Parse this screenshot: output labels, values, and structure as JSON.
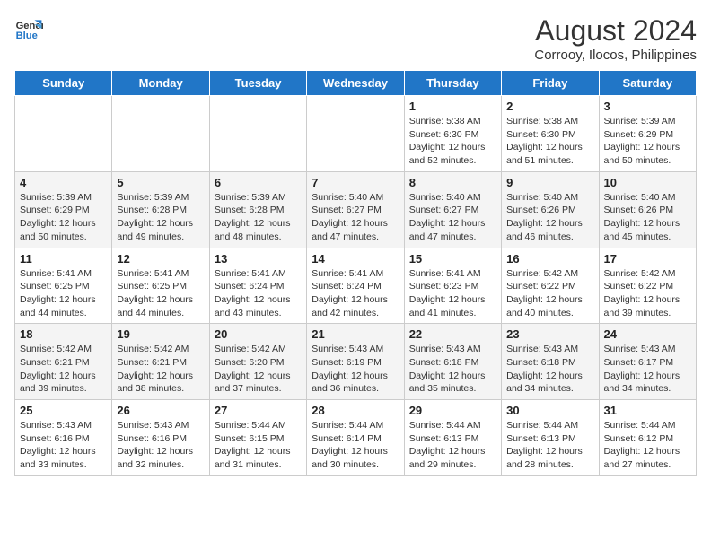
{
  "header": {
    "logo_line1": "General",
    "logo_line2": "Blue",
    "month_year": "August 2024",
    "location": "Corrooy, Ilocos, Philippines"
  },
  "days_of_week": [
    "Sunday",
    "Monday",
    "Tuesday",
    "Wednesday",
    "Thursday",
    "Friday",
    "Saturday"
  ],
  "weeks": [
    [
      {
        "day": "",
        "info": ""
      },
      {
        "day": "",
        "info": ""
      },
      {
        "day": "",
        "info": ""
      },
      {
        "day": "",
        "info": ""
      },
      {
        "day": "1",
        "info": "Sunrise: 5:38 AM\nSunset: 6:30 PM\nDaylight: 12 hours\nand 52 minutes."
      },
      {
        "day": "2",
        "info": "Sunrise: 5:38 AM\nSunset: 6:30 PM\nDaylight: 12 hours\nand 51 minutes."
      },
      {
        "day": "3",
        "info": "Sunrise: 5:39 AM\nSunset: 6:29 PM\nDaylight: 12 hours\nand 50 minutes."
      }
    ],
    [
      {
        "day": "4",
        "info": "Sunrise: 5:39 AM\nSunset: 6:29 PM\nDaylight: 12 hours\nand 50 minutes."
      },
      {
        "day": "5",
        "info": "Sunrise: 5:39 AM\nSunset: 6:28 PM\nDaylight: 12 hours\nand 49 minutes."
      },
      {
        "day": "6",
        "info": "Sunrise: 5:39 AM\nSunset: 6:28 PM\nDaylight: 12 hours\nand 48 minutes."
      },
      {
        "day": "7",
        "info": "Sunrise: 5:40 AM\nSunset: 6:27 PM\nDaylight: 12 hours\nand 47 minutes."
      },
      {
        "day": "8",
        "info": "Sunrise: 5:40 AM\nSunset: 6:27 PM\nDaylight: 12 hours\nand 47 minutes."
      },
      {
        "day": "9",
        "info": "Sunrise: 5:40 AM\nSunset: 6:26 PM\nDaylight: 12 hours\nand 46 minutes."
      },
      {
        "day": "10",
        "info": "Sunrise: 5:40 AM\nSunset: 6:26 PM\nDaylight: 12 hours\nand 45 minutes."
      }
    ],
    [
      {
        "day": "11",
        "info": "Sunrise: 5:41 AM\nSunset: 6:25 PM\nDaylight: 12 hours\nand 44 minutes."
      },
      {
        "day": "12",
        "info": "Sunrise: 5:41 AM\nSunset: 6:25 PM\nDaylight: 12 hours\nand 44 minutes."
      },
      {
        "day": "13",
        "info": "Sunrise: 5:41 AM\nSunset: 6:24 PM\nDaylight: 12 hours\nand 43 minutes."
      },
      {
        "day": "14",
        "info": "Sunrise: 5:41 AM\nSunset: 6:24 PM\nDaylight: 12 hours\nand 42 minutes."
      },
      {
        "day": "15",
        "info": "Sunrise: 5:41 AM\nSunset: 6:23 PM\nDaylight: 12 hours\nand 41 minutes."
      },
      {
        "day": "16",
        "info": "Sunrise: 5:42 AM\nSunset: 6:22 PM\nDaylight: 12 hours\nand 40 minutes."
      },
      {
        "day": "17",
        "info": "Sunrise: 5:42 AM\nSunset: 6:22 PM\nDaylight: 12 hours\nand 39 minutes."
      }
    ],
    [
      {
        "day": "18",
        "info": "Sunrise: 5:42 AM\nSunset: 6:21 PM\nDaylight: 12 hours\nand 39 minutes."
      },
      {
        "day": "19",
        "info": "Sunrise: 5:42 AM\nSunset: 6:21 PM\nDaylight: 12 hours\nand 38 minutes."
      },
      {
        "day": "20",
        "info": "Sunrise: 5:42 AM\nSunset: 6:20 PM\nDaylight: 12 hours\nand 37 minutes."
      },
      {
        "day": "21",
        "info": "Sunrise: 5:43 AM\nSunset: 6:19 PM\nDaylight: 12 hours\nand 36 minutes."
      },
      {
        "day": "22",
        "info": "Sunrise: 5:43 AM\nSunset: 6:18 PM\nDaylight: 12 hours\nand 35 minutes."
      },
      {
        "day": "23",
        "info": "Sunrise: 5:43 AM\nSunset: 6:18 PM\nDaylight: 12 hours\nand 34 minutes."
      },
      {
        "day": "24",
        "info": "Sunrise: 5:43 AM\nSunset: 6:17 PM\nDaylight: 12 hours\nand 34 minutes."
      }
    ],
    [
      {
        "day": "25",
        "info": "Sunrise: 5:43 AM\nSunset: 6:16 PM\nDaylight: 12 hours\nand 33 minutes."
      },
      {
        "day": "26",
        "info": "Sunrise: 5:43 AM\nSunset: 6:16 PM\nDaylight: 12 hours\nand 32 minutes."
      },
      {
        "day": "27",
        "info": "Sunrise: 5:44 AM\nSunset: 6:15 PM\nDaylight: 12 hours\nand 31 minutes."
      },
      {
        "day": "28",
        "info": "Sunrise: 5:44 AM\nSunset: 6:14 PM\nDaylight: 12 hours\nand 30 minutes."
      },
      {
        "day": "29",
        "info": "Sunrise: 5:44 AM\nSunset: 6:13 PM\nDaylight: 12 hours\nand 29 minutes."
      },
      {
        "day": "30",
        "info": "Sunrise: 5:44 AM\nSunset: 6:13 PM\nDaylight: 12 hours\nand 28 minutes."
      },
      {
        "day": "31",
        "info": "Sunrise: 5:44 AM\nSunset: 6:12 PM\nDaylight: 12 hours\nand 27 minutes."
      }
    ]
  ]
}
